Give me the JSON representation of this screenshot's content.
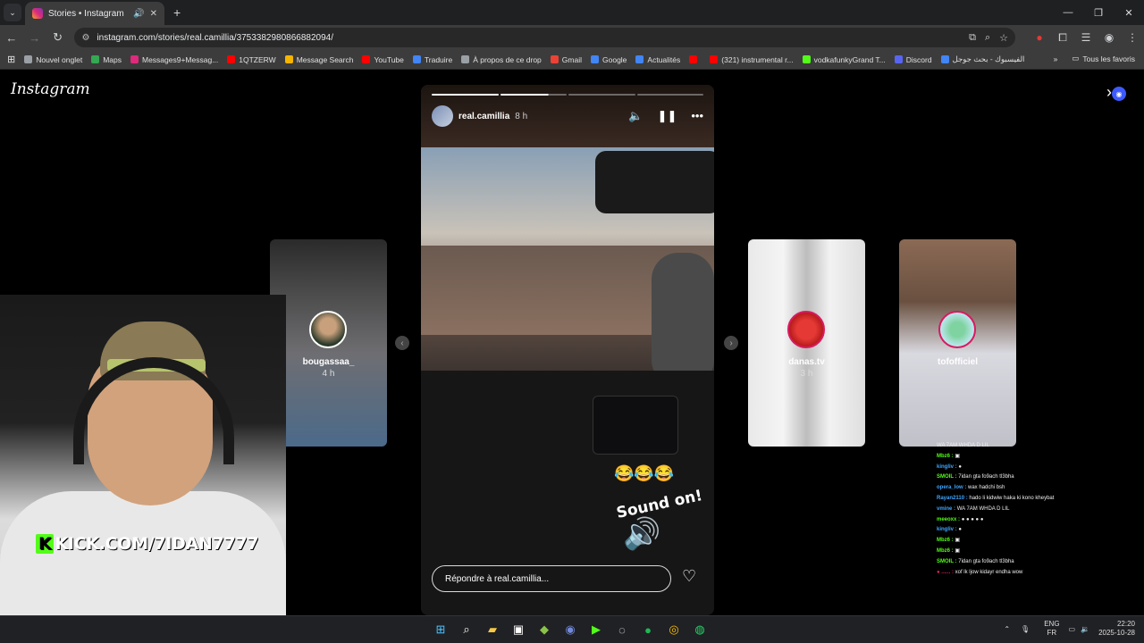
{
  "browser": {
    "tab": {
      "title": "Stories • Instagram",
      "sound_icon": "🔊",
      "close_icon": "✕"
    },
    "new_tab": "+",
    "url": "instagram.com/stories/real.camillia/3753382980866882094/",
    "window_controls": [
      "—",
      "❐",
      "✕"
    ],
    "bookmarks": [
      {
        "label": "Nouvel onglet",
        "color": "#9aa0a6"
      },
      {
        "label": "Maps",
        "color": "#34a853"
      },
      {
        "label": "Messages9+Messag...",
        "color": "#dd2a7b"
      },
      {
        "label": "1QTZERW",
        "color": "#ff0000"
      },
      {
        "label": "Message Search",
        "color": "#f4b400"
      },
      {
        "label": "YouTube",
        "color": "#ff0000"
      },
      {
        "label": "Traduire",
        "color": "#4285f4"
      },
      {
        "label": "À propos de ce drop",
        "color": "#9aa0a6"
      },
      {
        "label": "Gmail",
        "color": "#ea4335"
      },
      {
        "label": "Google",
        "color": "#4285f4"
      },
      {
        "label": "Actualités",
        "color": "#4285f4"
      },
      {
        "label": "",
        "color": "#ff0000"
      },
      {
        "label": "(321) instrumental r...",
        "color": "#ff0000"
      },
      {
        "label": "vodkafunkyGrand T...",
        "color": "#53fc18"
      },
      {
        "label": "Discord",
        "color": "#5865f2"
      },
      {
        "label": "الفيسبوك - بحث جوجل",
        "color": "#4285f4"
      }
    ],
    "all_bookmarks": "Tous les favoris"
  },
  "instagram": {
    "logo": "Instagram",
    "story": {
      "username": "real.camillia",
      "time": "8 h",
      "progress_segments": [
        "done",
        "partial",
        "empty",
        "empty"
      ],
      "emoji": "😂😂😂",
      "sound_on": "Sound on!",
      "reply_placeholder": "Répondre à real.camillia..."
    },
    "previews": [
      {
        "name": "bougassaa_",
        "time": "4 h"
      },
      {
        "name": "danas.tv",
        "time": "3 h"
      },
      {
        "name": "tofofficiel",
        "time": ""
      }
    ]
  },
  "stream": {
    "overlay_text": "KICK.COM/7IDAN7777"
  },
  "chat": [
    {
      "user": "",
      "msg": "WA 7AM WHDA D LIL",
      "color": "#ffffff"
    },
    {
      "user": "Mbz6 :",
      "msg": "▣",
      "color": "#53fc18"
    },
    {
      "user": "kingliv :",
      "msg": "●",
      "color": "#3ea6ff"
    },
    {
      "user": "SMOIL :",
      "msg": "7idan gta fo9ach tl3bha",
      "color": "#53fc18"
    },
    {
      "user": "opera_low :",
      "msg": "wax hadchi bsh",
      "color": "#3ea6ff"
    },
    {
      "user": "Rayan2110 :",
      "msg": "hado li kidwiw haka ki kono kheybat",
      "color": "#3ea6ff"
    },
    {
      "user": "vmine :",
      "msg": "WA 7AM WHDA D LIL",
      "color": "#3ea6ff"
    },
    {
      "user": "meeoxx :",
      "msg": "● ● ● ● ●",
      "color": "#53fc18"
    },
    {
      "user": "kingliv :",
      "msg": "●",
      "color": "#3ea6ff"
    },
    {
      "user": "Mbz6 :",
      "msg": "▣",
      "color": "#53fc18"
    },
    {
      "user": "Mbz6 :",
      "msg": "▣",
      "color": "#53fc18"
    },
    {
      "user": "SMOIL :",
      "msg": "7idan gta fo9ach tl3bha",
      "color": "#53fc18"
    },
    {
      "user": "● ...... :",
      "msg": "xof lk ljow kidayr endha wow",
      "color": "#e91e63"
    }
  ],
  "taskbar": {
    "apps": [
      "start",
      "search",
      "files",
      "store",
      "bluestacks",
      "discord",
      "kick",
      "clock",
      "spotify",
      "chrome",
      "whatsapp"
    ],
    "lang_top": "ENG",
    "lang_bottom": "FR",
    "time": "22:20",
    "date": "2025-10-28"
  }
}
